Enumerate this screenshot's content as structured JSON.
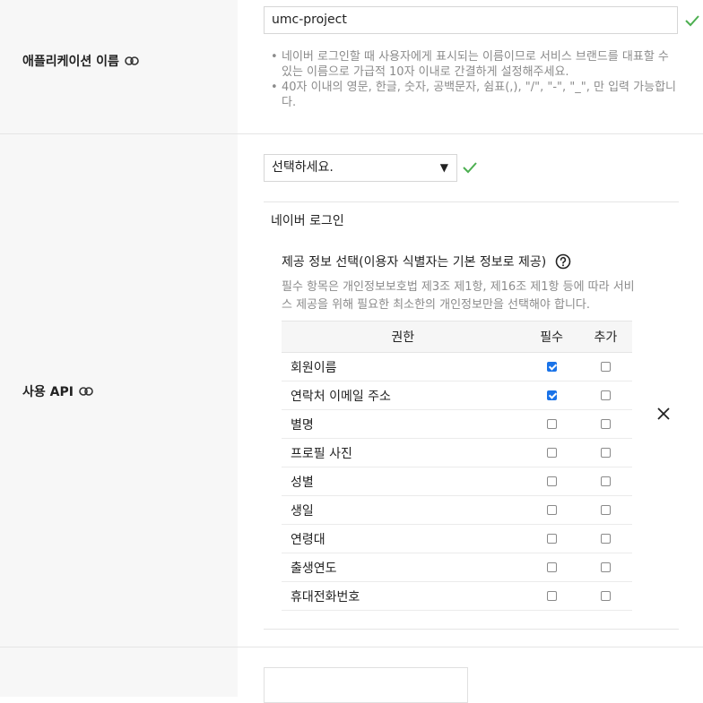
{
  "app_name": {
    "label": "애플리케이션 이름",
    "value": "umc-project",
    "hints": [
      "네이버 로그인할 때 사용자에게 표시되는 이름이므로 서비스 브랜드를 대표할 수 있는 이름으로 가급적 10자 이내로 간결하게 설정해주세요.",
      "40자 이내의 영문, 한글, 숫자, 공백문자, 쉼표(,), \"/\", \"-\", \"_\", 만 입력 가능합니다."
    ]
  },
  "api": {
    "label": "사용 API",
    "select_value": "선택하세요.",
    "panel_title": "네이버 로그인",
    "provide_title": "제공 정보 선택(이용자 식별자는 기본 정보로 제공)",
    "provide_desc": "필수 항목은 개인정보보호법 제3조 제1항, 제16조 제1항 등에 따라 서비스 제공을 위해 필요한 최소한의 개인정보만을 선택해야 합니다.",
    "columns": [
      "권한",
      "필수",
      "추가"
    ],
    "rows": [
      {
        "name": "회원이름",
        "required": true,
        "optional": false
      },
      {
        "name": "연락처 이메일 주소",
        "required": true,
        "optional": false
      },
      {
        "name": "별명",
        "required": false,
        "optional": false
      },
      {
        "name": "프로필 사진",
        "required": false,
        "optional": false
      },
      {
        "name": "성별",
        "required": false,
        "optional": false
      },
      {
        "name": "생일",
        "required": false,
        "optional": false
      },
      {
        "name": "연령대",
        "required": false,
        "optional": false
      },
      {
        "name": "출생연도",
        "required": false,
        "optional": false
      },
      {
        "name": "휴대전화번호",
        "required": false,
        "optional": false
      }
    ]
  },
  "icons": {
    "link": "link-icon",
    "check": "check-icon",
    "help": "question-circle-icon",
    "close": "close-icon",
    "dropdown": "triangle-down-icon"
  },
  "colors": {
    "check_green": "#4caf50",
    "checkbox_blue": "#1a73e8",
    "label_bg": "#f7f7f7",
    "hint_gray": "#8b8b8b"
  }
}
